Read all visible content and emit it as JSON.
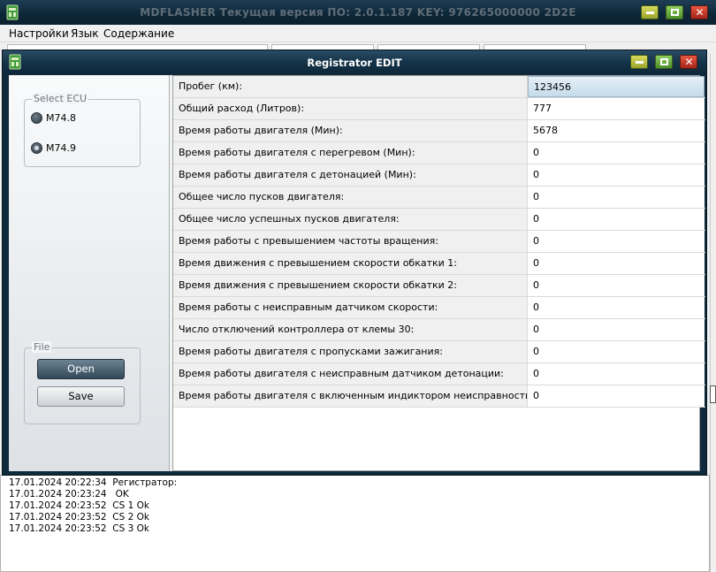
{
  "main_window": {
    "title": "MDFLASHER  Текущая версия ПО: 2.0.1.187  KEY: 976265000000 2D2E",
    "menu": [
      "Настройки",
      "Язык",
      "Содержание"
    ]
  },
  "log": {
    "lines": [
      "17.01.2024 20:22:34  Регистратор:",
      "17.01.2024 20:23:24   OK",
      "17.01.2024 20:23:52  CS 1 Ok",
      "17.01.2024 20:23:52  CS 2 Ok",
      "17.01.2024 20:23:52  CS 3 Ok"
    ]
  },
  "dialog": {
    "title": "Registrator EDIT",
    "select_ecu": {
      "legend": "Select ECU",
      "options": [
        "M74.8",
        "M74.9"
      ],
      "selected": "M74.9"
    },
    "file": {
      "legend": "File",
      "open_label": "Open",
      "save_label": "Save"
    },
    "rows": [
      {
        "label": "Пробег (км):",
        "value": "123456"
      },
      {
        "label": "Общий расход (Литров):",
        "value": "777"
      },
      {
        "label": "Время работы двигателя (Мин):",
        "value": "5678"
      },
      {
        "label": "Время работы двигателя с перегревом (Мин):",
        "value": "0"
      },
      {
        "label": "Время работы двигателя с детонацией (Мин):",
        "value": "0"
      },
      {
        "label": "Общее число пусков двигателя:",
        "value": "0"
      },
      {
        "label": "Общее число успешных пусков двигателя:",
        "value": "0"
      },
      {
        "label": "Время работы с превышением частоты вращения:",
        "value": "0"
      },
      {
        "label": "Время движения с превышением скорости обкатки 1:",
        "value": "0"
      },
      {
        "label": "Время движения с превышением скорости обкатки 2:",
        "value": "0"
      },
      {
        "label": "Время работы с неисправным датчиком скорости:",
        "value": "0"
      },
      {
        "label": "Число отключений контроллера от клемы 30:",
        "value": "0"
      },
      {
        "label": "Время работы двигателя с пропусками зажигания:",
        "value": "0"
      },
      {
        "label": "Время работы двигателя с неисправным датчиком детонации:",
        "value": "0"
      },
      {
        "label": "Время работы двигателя с включенным индиктором неисправности:",
        "value": "0"
      }
    ]
  },
  "colors": {
    "titlebar": "#0d2637",
    "selected_row": "#c5dcea",
    "open_button": "#33495a"
  }
}
